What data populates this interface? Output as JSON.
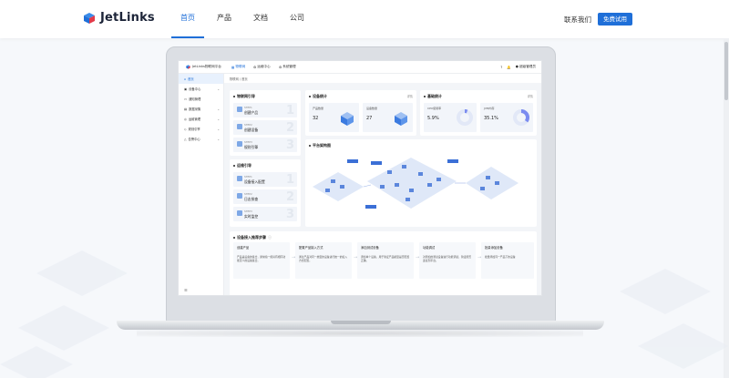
{
  "header": {
    "logo_text": "JetLinks",
    "menu": [
      "首页",
      "产品",
      "文档",
      "公司"
    ],
    "contact": "联系我们",
    "trial_button": "免费试用"
  },
  "dashboard": {
    "brand": "JetLinks物联网平台",
    "tabs": [
      "物联网",
      "运维中心",
      "系统管理"
    ],
    "user": "超级管理员",
    "breadcrumb": "物联网 / 首页",
    "sidebar": [
      "首页",
      "设备中心",
      "通知管理",
      "数据采集",
      "运维管理",
      "规则引擎",
      "告警中心"
    ],
    "guide": {
      "title": "物联网引导",
      "steps": [
        {
          "no": "STEP1",
          "name": "创建产品",
          "num": "1"
        },
        {
          "no": "STEP2",
          "name": "创建设备",
          "num": "2"
        },
        {
          "no": "STEP3",
          "name": "规则引擎",
          "num": "3"
        }
      ]
    },
    "ops": {
      "title": "运维引导",
      "steps": [
        {
          "no": "STEP1",
          "name": "设备接入配置",
          "num": "1"
        },
        {
          "no": "STEP2",
          "name": "日志排查",
          "num": "2"
        },
        {
          "no": "STEP3",
          "name": "实时监控",
          "num": "3"
        }
      ]
    },
    "device_stats": {
      "title": "设备统计",
      "more": "详情",
      "items": [
        {
          "label": "产品数量",
          "value": "32"
        },
        {
          "label": "设备数量",
          "value": "27"
        }
      ]
    },
    "basic_stats": {
      "title": "基础统计",
      "more": "详情",
      "items": [
        {
          "label": "CPU使用率",
          "value": "5.9%",
          "percent": 5.9
        },
        {
          "label": "JVM内存",
          "value": "35.1%",
          "percent": 35.1
        }
      ]
    },
    "arch": {
      "title": "平台架构图"
    },
    "access": {
      "title": "设备接入推荐步骤",
      "steps": [
        {
          "title": "创建产品",
          "desc": "产品是设备的集合，通常指一组具有相同功能定义的设备集合。"
        },
        {
          "title": "配置产品接入方式",
          "desc": "通过产品对同一类型的设备进行统一的接入方式配置。"
        },
        {
          "title": "添加测试设备",
          "desc": "添加单个设备，用于验证产品模型是否配置正确。"
        },
        {
          "title": "功能调试",
          "desc": "对添加的测试设备进行功能调试，验证能否连接到平台。"
        },
        {
          "title": "批量添加设备",
          "desc": "批量添加同一产品下的设备"
        }
      ]
    }
  }
}
